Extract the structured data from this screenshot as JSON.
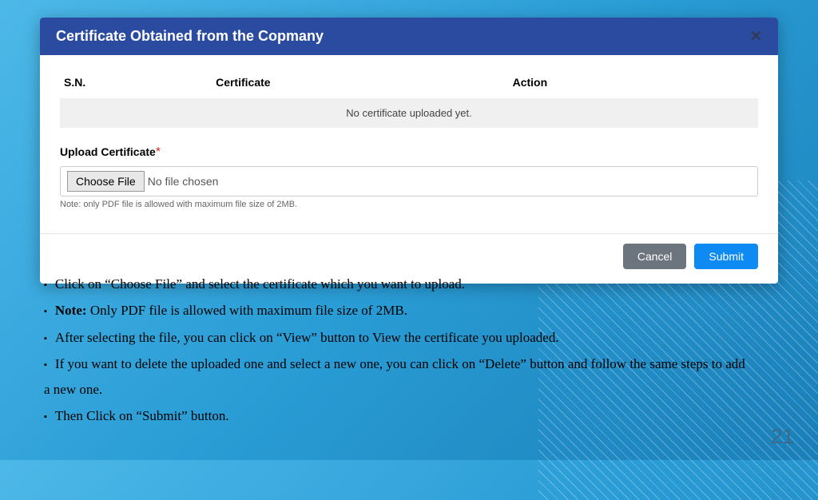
{
  "modal": {
    "title": "Certificate Obtained from the Copmany",
    "close": "✕",
    "columns": {
      "sn": "S.N.",
      "cert": "Certificate",
      "action": "Action"
    },
    "empty": "No certificate uploaded yet.",
    "upload_label": "Upload Certificate",
    "required": "*",
    "choose_file": "Choose File",
    "file_status": "No file chosen",
    "file_note": "Note: only PDF file is allowed with maximum file size of 2MB.",
    "cancel": "Cancel",
    "submit": "Submit"
  },
  "instructions": {
    "i1": "Click on “Choose File” and select the certificate which you want to upload.",
    "i2_bold": "Note:",
    "i2_rest": " Only PDF file is allowed with maximum file size of 2MB.",
    "i3": "After selecting the file, you can click on “View” button to View the certificate you uploaded.",
    "i4": "If you want to delete the uploaded one and select a new one, you can click on “Delete” button and follow the same steps to add a new one.",
    "i5": "Then Click on “Submit” button."
  },
  "page_number": "21"
}
